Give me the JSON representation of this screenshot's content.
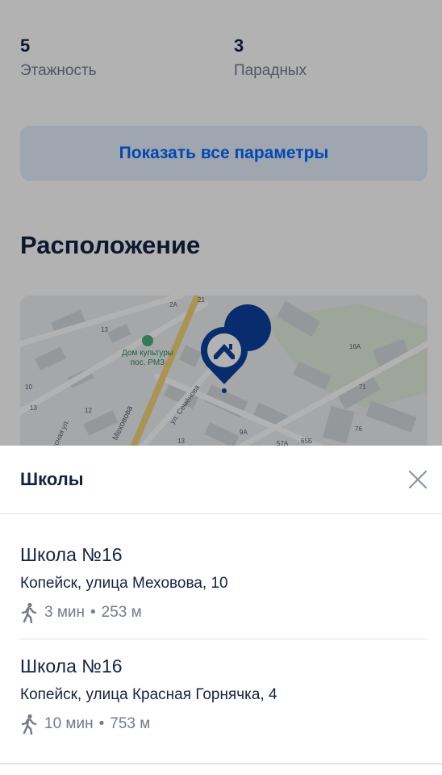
{
  "params": [
    {
      "value": "5",
      "label": "Этажность"
    },
    {
      "value": "3",
      "label": "Парадных"
    }
  ],
  "show_all_label": "Показать все параметры",
  "location_title": "Расположение",
  "map": {
    "poi_label_line1": "Дом культуры",
    "poi_label_line2": "пос. РМЗ",
    "street_1": "Меховова",
    "street_2": "ул. Семёнова",
    "street_3": "Красная ул.",
    "building_numbers": [
      "2А",
      "13",
      "16А",
      "10",
      "13",
      "12",
      "71",
      "13",
      "21",
      "9А",
      "57А",
      "65Б",
      "76"
    ]
  },
  "sheet": {
    "title": "Школы",
    "schools": [
      {
        "name": "Школа №16",
        "address": "Копейск, улица Меховова, 10",
        "time": "3 мин",
        "distance": "253 м"
      },
      {
        "name": "Школа №16",
        "address": "Копейск, улица Красная Горнячка, 4",
        "time": "10 мин",
        "distance": "753 м"
      }
    ]
  },
  "colors": {
    "accent": "#0468ff",
    "pin": "#0c3f9c",
    "text": "#152242",
    "muted": "#737a8e"
  }
}
